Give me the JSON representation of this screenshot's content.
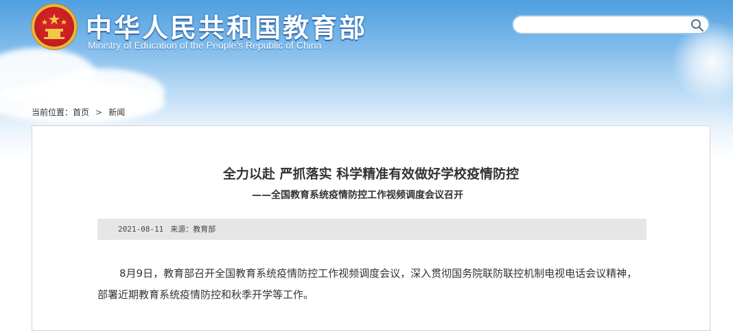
{
  "header": {
    "title": "中华人民共和国教育部",
    "subtitle": "Ministry of Education of the People's Republic of China",
    "emblem_icon": "national-emblem-icon"
  },
  "search": {
    "placeholder": "",
    "value": "",
    "icon": "search-icon"
  },
  "breadcrumb": {
    "label": "当前位置：",
    "home": "首页",
    "separator": ">",
    "current": "新闻"
  },
  "article": {
    "title": "全力以赴 严抓落实 科学精准有效做好学校疫情防控",
    "subtitle": "——全国教育系统疫情防控工作视频调度会议召开",
    "date": "2021-08-11",
    "source": "来源：教育部",
    "paragraph": "8月9日，教育部召开全国教育系统疫情防控工作视频调度会议，深入贯彻国务院联防联控机制电视电话会议精神，部署近期教育系统疫情防控和秋季开学等工作。"
  },
  "colors": {
    "sky_blue": "#4f9fe0",
    "emblem_red": "#c81e22",
    "emblem_gold": "#e7b93b",
    "meta_bar": "#e6e6e6",
    "text": "#333333"
  }
}
